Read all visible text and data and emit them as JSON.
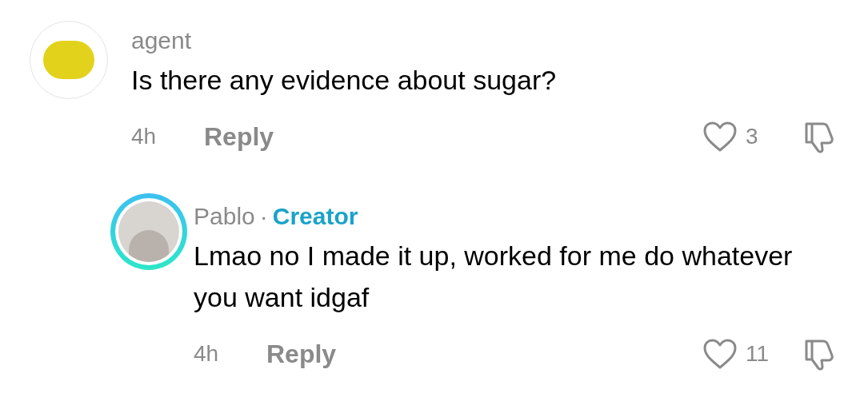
{
  "comments": [
    {
      "username": "agent",
      "text": "Is there any evidence about sugar?",
      "time": "4h",
      "reply_label": "Reply",
      "likes": "3",
      "replies": [
        {
          "username": "Pablo",
          "separator": "·",
          "badge": "Creator",
          "text": "Lmao no I made it up, worked for me do whatever you want idgaf",
          "time": "4h",
          "reply_label": "Reply",
          "likes": "11"
        }
      ]
    }
  ]
}
